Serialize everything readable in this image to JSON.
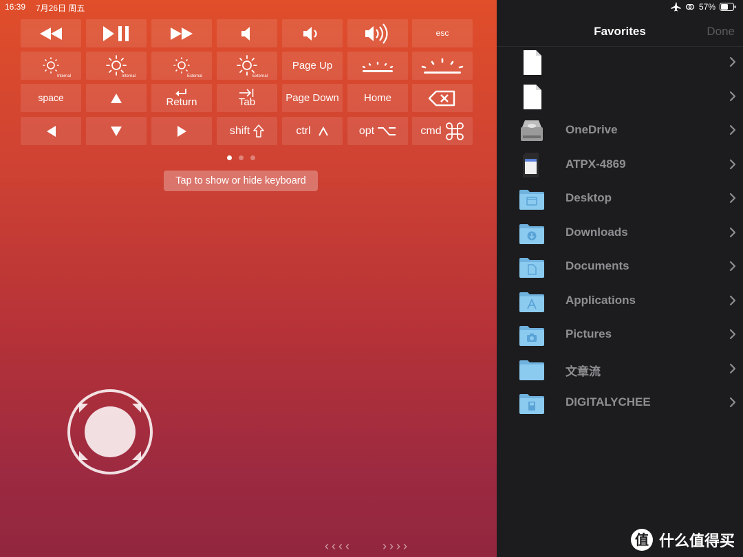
{
  "status": {
    "time": "16:39",
    "date": "7月26日 周五",
    "battery": "57%"
  },
  "keys": {
    "esc": "esc",
    "internal": "Internal",
    "external": "External",
    "page_up": "Page Up",
    "space": "space",
    "return": "Return",
    "tab": "Tab",
    "page_down": "Page Down",
    "home": "Home",
    "shift": "shift",
    "ctrl": "ctrl",
    "opt": "opt",
    "cmd": "cmd"
  },
  "keyboard_hint": "Tap to show or hide keyboard",
  "nav": {
    "left": "‹‹‹‹",
    "right": "››››"
  },
  "pager": {
    "pages": 3,
    "current": 1
  },
  "sidebar": {
    "title": "Favorites",
    "done_label": "Done",
    "items": [
      {
        "label": "",
        "icon": "file-icon"
      },
      {
        "label": "",
        "icon": "file-icon"
      },
      {
        "label": "OneDrive",
        "icon": "drive-icon"
      },
      {
        "label": "ATPX-4869",
        "icon": "sd-card-icon"
      },
      {
        "label": "Desktop",
        "icon": "desktop-folder-icon"
      },
      {
        "label": "Downloads",
        "icon": "downloads-folder-icon"
      },
      {
        "label": "Documents",
        "icon": "documents-folder-icon"
      },
      {
        "label": "Applications",
        "icon": "applications-folder-icon"
      },
      {
        "label": "Pictures",
        "icon": "pictures-folder-icon"
      },
      {
        "label": "文章流",
        "icon": "folder-icon"
      },
      {
        "label": "DIGITALYCHEE",
        "icon": "disk-folder-icon"
      }
    ]
  },
  "watermark": "什么值得买",
  "colors": {
    "accent_folder": "#8ccbf0",
    "gradient_top": "#e04e2a",
    "gradient_bottom": "#92263f",
    "panel_bg": "#1c1c1e"
  }
}
